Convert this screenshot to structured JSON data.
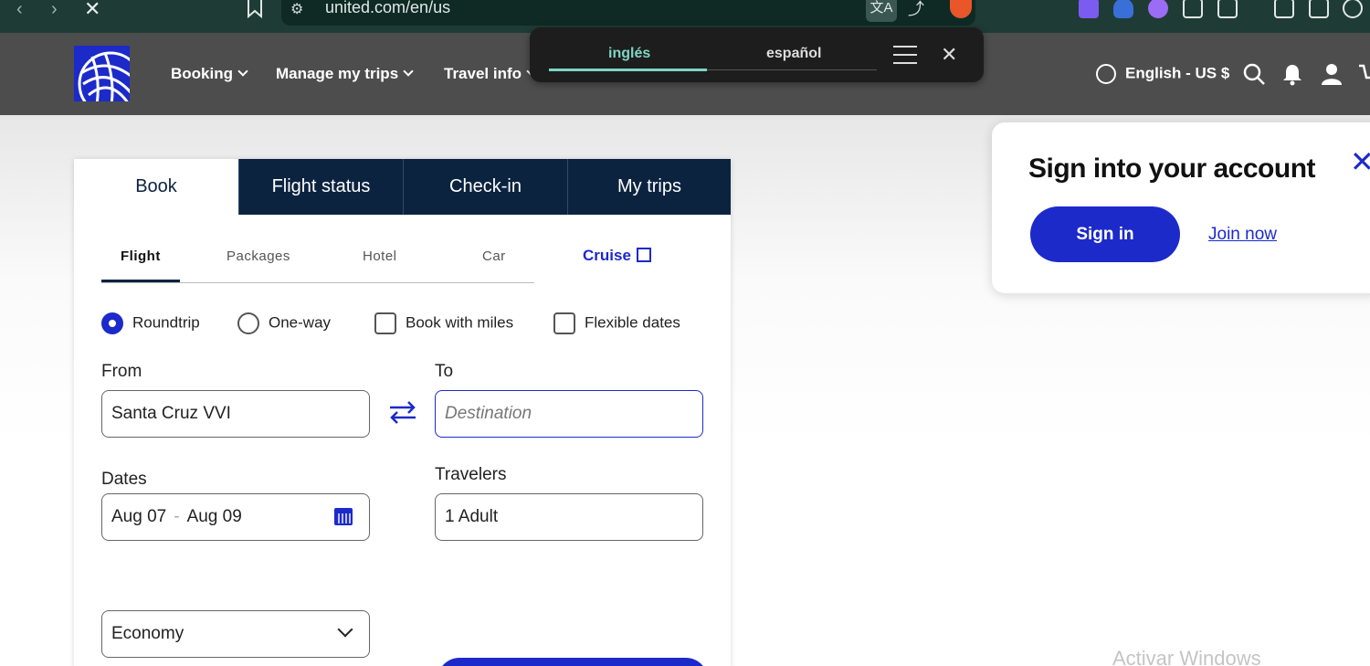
{
  "browser": {
    "url": "united.com/en/us",
    "back_icon": "back-icon",
    "forward_icon": "forward-icon",
    "close_icon": "close-icon"
  },
  "translate_popup": {
    "tab_source": "inglés",
    "tab_target": "español",
    "accent": "#7fd4c4"
  },
  "header": {
    "nav": [
      "Booking",
      "Manage my trips",
      "Travel info"
    ],
    "language": "English - US $",
    "brand_color": "#1c2aca"
  },
  "booking": {
    "main_tabs": [
      "Book",
      "Flight status",
      "Check-in",
      "My trips"
    ],
    "sub_tabs": [
      "Flight",
      "Packages",
      "Hotel",
      "Car"
    ],
    "cruise_label": "Cruise",
    "trip_options": {
      "roundtrip": "Roundtrip",
      "oneway": "One-way",
      "miles": "Book with miles",
      "flexible": "Flexible dates",
      "selected": "Roundtrip"
    },
    "from_label": "From",
    "from_value": "Santa Cruz VVI",
    "to_label": "To",
    "to_placeholder": "Destination",
    "dates_label": "Dates",
    "date_depart": "Aug 07",
    "date_return": "Aug 09",
    "travelers_label": "Travelers",
    "travelers_value": "1 Adult",
    "cabin_value": "Economy"
  },
  "signin_panel": {
    "title": "Sign into your account",
    "signin_button": "Sign in",
    "join_link": "Join now"
  },
  "watermark": "Activar Windows"
}
